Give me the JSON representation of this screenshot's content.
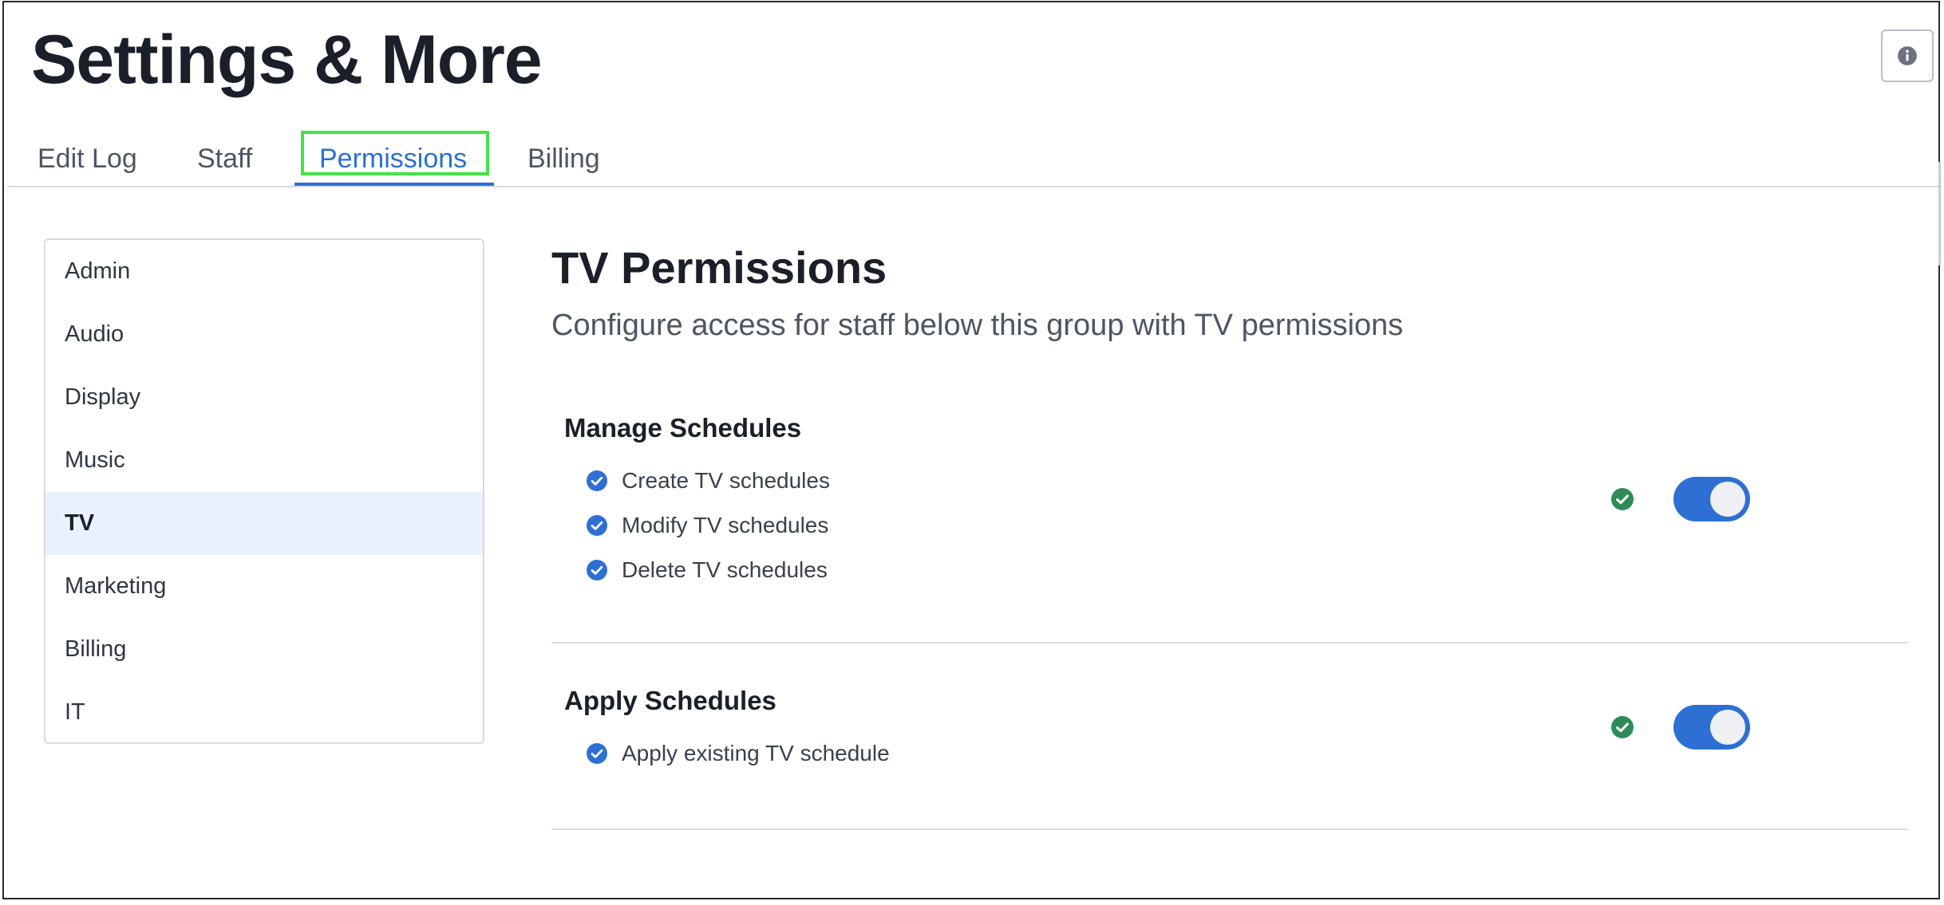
{
  "header": {
    "title": "Settings & More",
    "info_icon": "info-icon"
  },
  "tabs": [
    {
      "label": "Edit Log",
      "active": false
    },
    {
      "label": "Staff",
      "active": false
    },
    {
      "label": "Permissions",
      "active": true
    },
    {
      "label": "Billing",
      "active": false
    }
  ],
  "sidebar": {
    "items": [
      {
        "label": "Admin",
        "selected": false
      },
      {
        "label": "Audio",
        "selected": false
      },
      {
        "label": "Display",
        "selected": false
      },
      {
        "label": "Music",
        "selected": false
      },
      {
        "label": "TV",
        "selected": true
      },
      {
        "label": "Marketing",
        "selected": false
      },
      {
        "label": "Billing",
        "selected": false
      },
      {
        "label": "IT",
        "selected": false
      }
    ]
  },
  "content": {
    "title": "TV Permissions",
    "subtitle": "Configure access for staff below this group with TV permissions",
    "sections": [
      {
        "heading": "Manage Schedules",
        "items": [
          "Create TV schedules",
          "Modify TV schedules",
          "Delete TV schedules"
        ],
        "enabled": true,
        "status": "granted"
      },
      {
        "heading": "Apply Schedules",
        "items": [
          "Apply existing TV schedule"
        ],
        "enabled": true,
        "status": "granted"
      }
    ]
  },
  "colors": {
    "accent": "#2d6fd3",
    "success": "#2e8b57",
    "focus_outline": "#44e34a",
    "selected_bg": "#e9f1fd"
  }
}
